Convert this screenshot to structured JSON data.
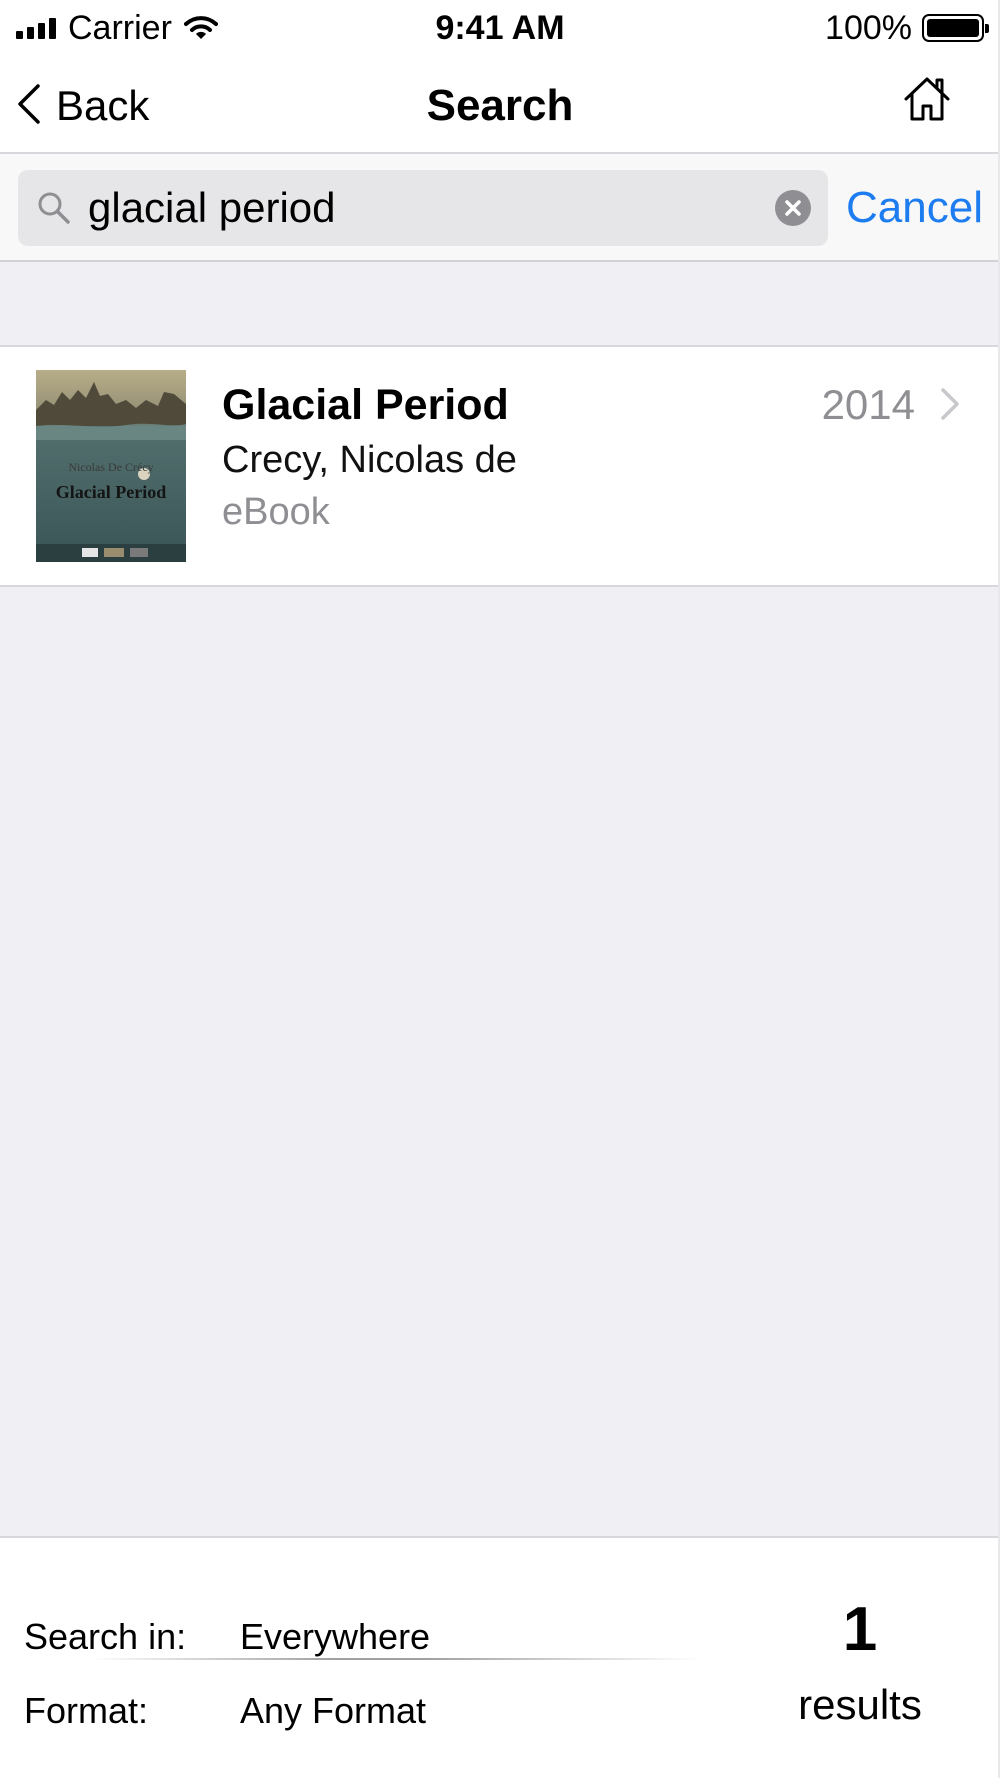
{
  "status_bar": {
    "carrier": "Carrier",
    "time": "9:41 AM",
    "battery": "100%"
  },
  "nav": {
    "back_label": "Back",
    "title": "Search",
    "home_icon": "home-icon"
  },
  "search": {
    "query": "glacial period",
    "cancel_label": "Cancel"
  },
  "results": [
    {
      "title": "Glacial Period",
      "author": "Crecy, Nicolas de",
      "format": "eBook",
      "year": "2014",
      "cover_title": "Glacial Period",
      "cover_author": "Nicolas De Crécy"
    }
  ],
  "footer": {
    "search_in_label": "Search in:",
    "search_in_value": "Everywhere",
    "format_label": "Format:",
    "format_value": "Any Format",
    "results_count": "1",
    "results_label": "results"
  },
  "colors": {
    "accent": "#1c7cf0",
    "secondary_text": "#8e8e93",
    "background": "#efeff4"
  }
}
